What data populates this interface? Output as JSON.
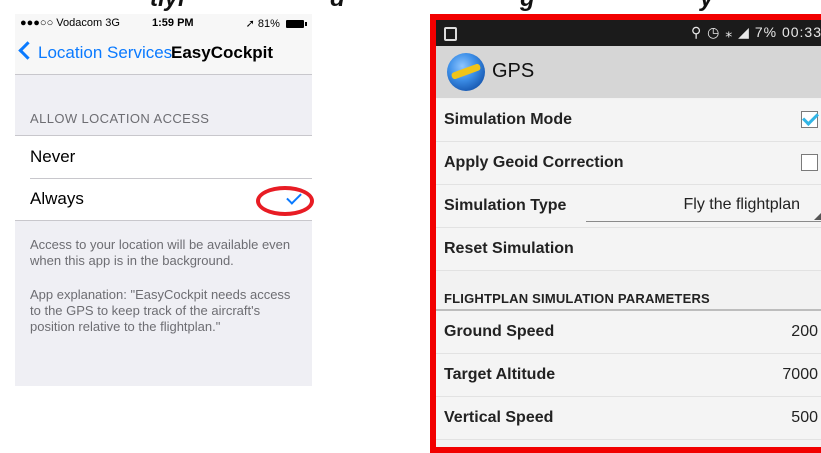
{
  "caption": {
    "fragments": [
      "tlyi",
      "d",
      "g",
      "y"
    ]
  },
  "ios": {
    "status": {
      "carrier": "●●●○○ Vodacom  3G",
      "time": "1:59 PM",
      "battery": "81%"
    },
    "nav": {
      "back_label": "Location Services",
      "title": "EasyCockpit"
    },
    "section_header": "ALLOW LOCATION ACCESS",
    "options": [
      {
        "label": "Never",
        "selected": false
      },
      {
        "label": "Always",
        "selected": true
      }
    ],
    "footer_1": "Access to your location will be available even when this app is in the background.",
    "footer_2": "App explanation: \"EasyCockpit needs access to the GPS to keep track of the aircraft's position relative to the flightplan.\""
  },
  "android": {
    "status": {
      "icons": "⚲ ◷ ⁎ ◢ 7%",
      "time": "00:33"
    },
    "app_title": "GPS",
    "rows": {
      "simulation_mode": {
        "label": "Simulation Mode",
        "checked": true
      },
      "apply_geoid": {
        "label": "Apply Geoid Correction",
        "checked": false
      },
      "simulation_type": {
        "label": "Simulation Type",
        "value": "Fly the flightplan"
      },
      "reset": {
        "label": "Reset Simulation"
      }
    },
    "section_header": "FLIGHTPLAN SIMULATION PARAMETERS",
    "params": [
      {
        "label": "Ground Speed",
        "value": "200"
      },
      {
        "label": "Target Altitude",
        "value": "7000"
      },
      {
        "label": "Vertical Speed",
        "value": "500"
      }
    ],
    "colors": {
      "frame": "#f20000",
      "checkbox_accent": "#33b5e5",
      "ios_tint": "#0a7aff",
      "highlight_oval": "#e81c24"
    }
  }
}
